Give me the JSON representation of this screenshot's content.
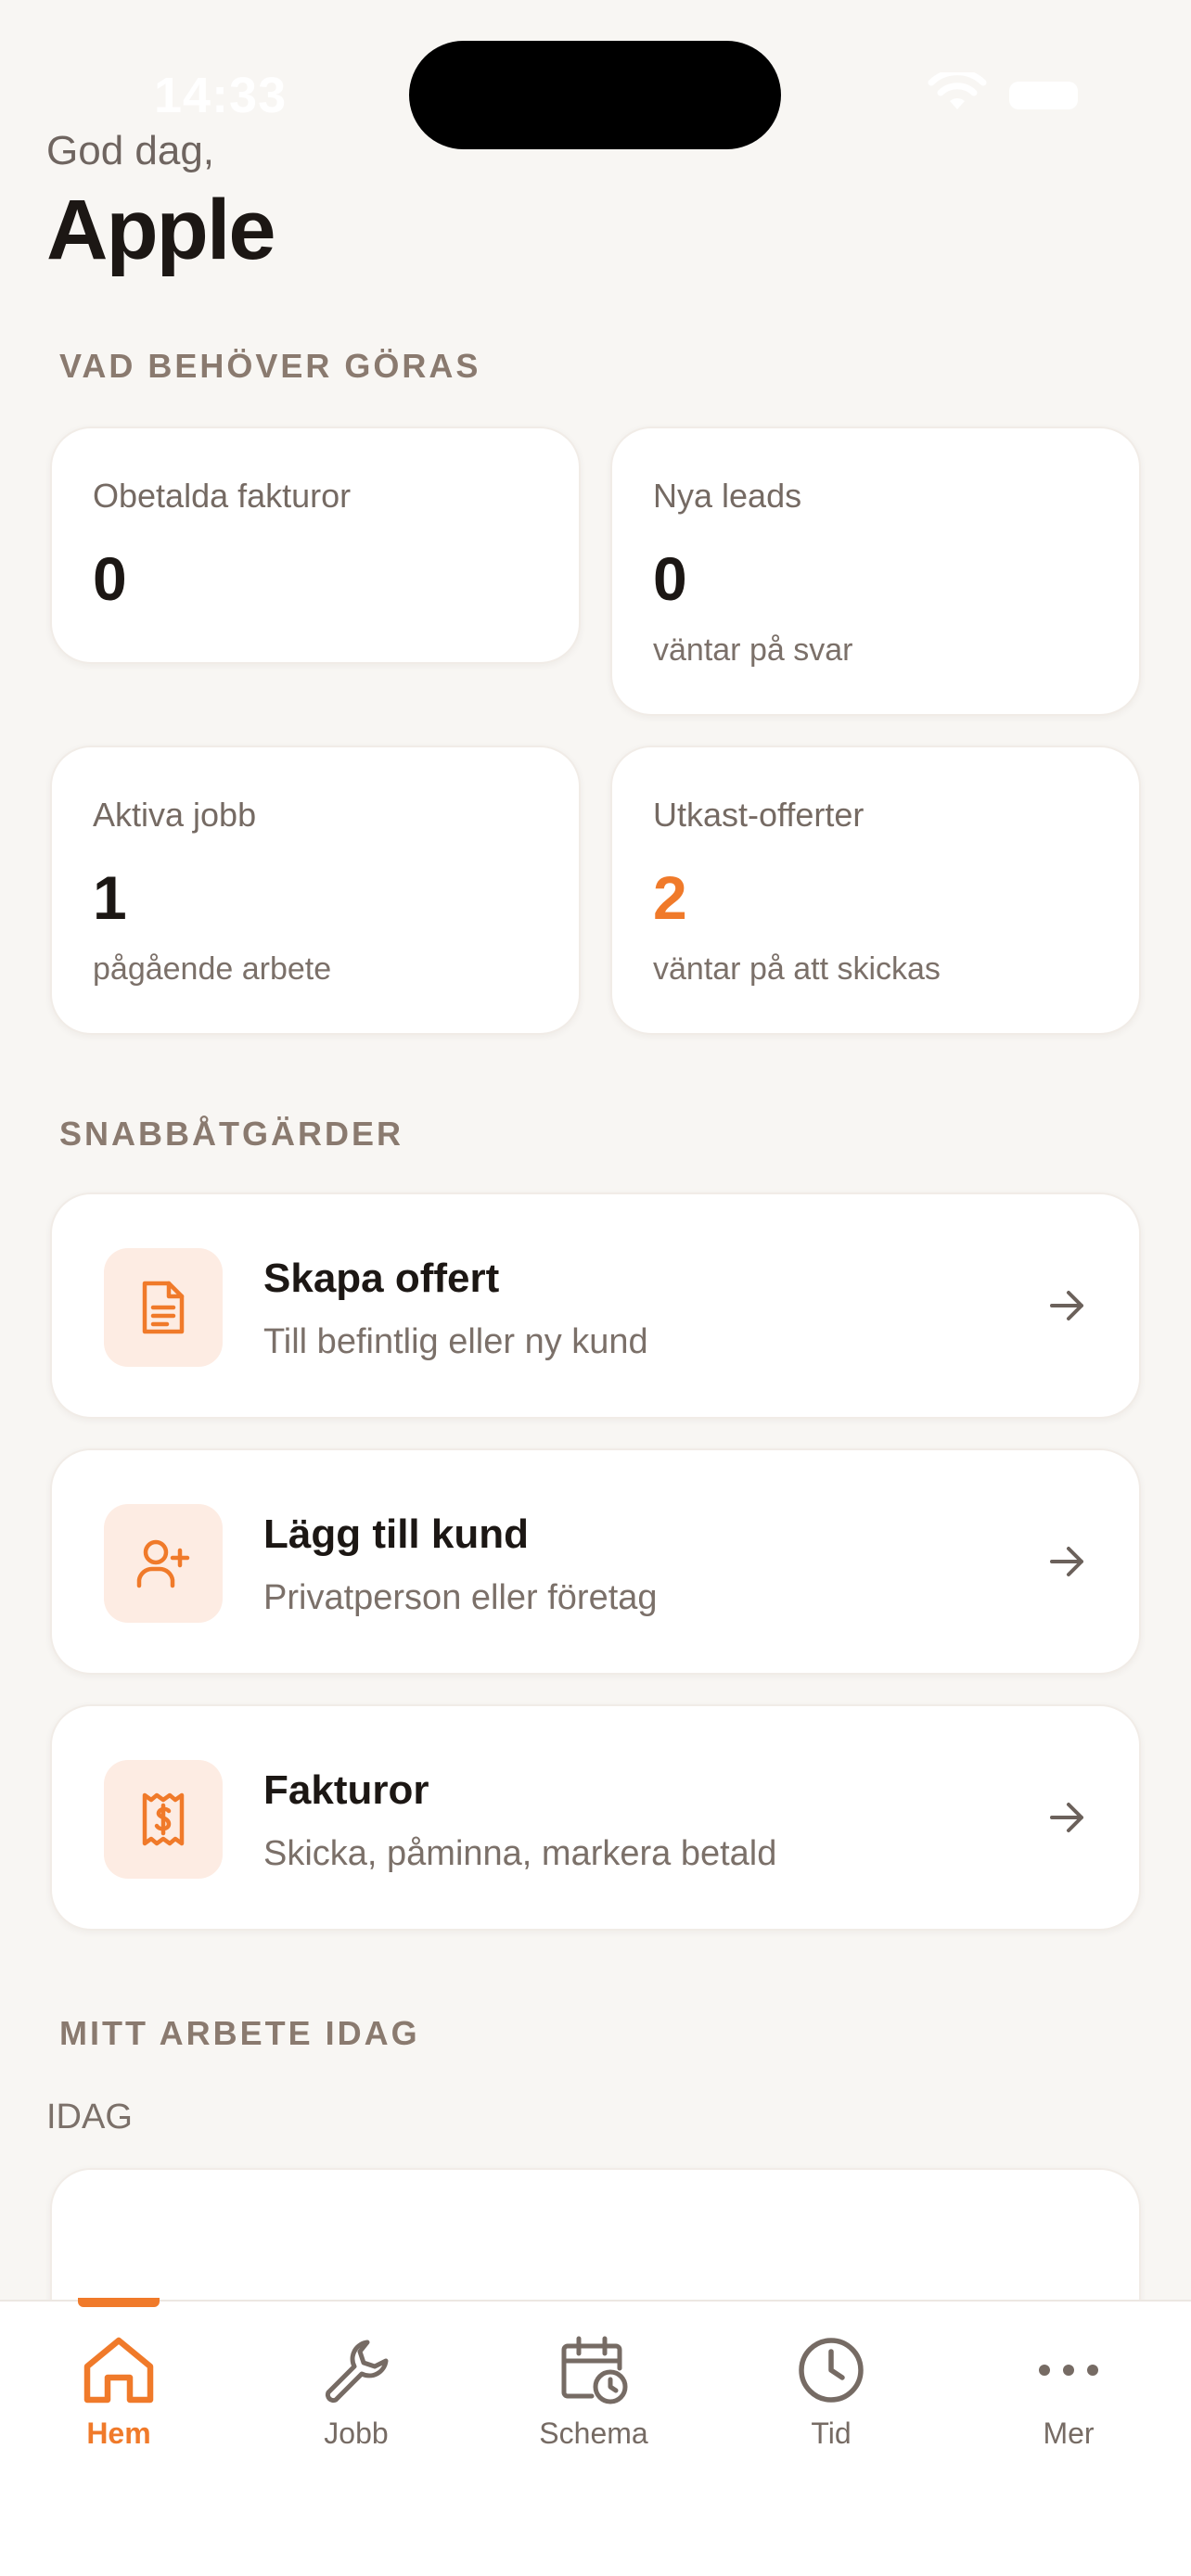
{
  "status": {
    "time": "14:33"
  },
  "header": {
    "greeting": "God dag,",
    "name": "Apple"
  },
  "sections": {
    "todo": "VAD BEHÖVER GÖRAS",
    "quick": "SNABBÅTGÄRDER",
    "today": "MITT ARBETE IDAG"
  },
  "stats": [
    {
      "label": "Obetalda fakturor",
      "value": "0",
      "sub": ""
    },
    {
      "label": "Nya leads",
      "value": "0",
      "sub": "väntar på svar"
    },
    {
      "label": "Aktiva jobb",
      "value": "1",
      "sub": "pågående arbete"
    },
    {
      "label": "Utkast-offerter",
      "value": "2",
      "sub": "väntar på att skickas"
    }
  ],
  "actions": [
    {
      "title": "Skapa offert",
      "sub": "Till befintlig eller ny kund",
      "icon": "document-icon"
    },
    {
      "title": "Lägg till kund",
      "sub": "Privatperson eller företag",
      "icon": "user-plus-icon"
    },
    {
      "title": "Fakturor",
      "sub": "Skicka, påminna, markera betald",
      "icon": "receipt-icon"
    }
  ],
  "today": {
    "label": "IDAG"
  },
  "tabs": [
    {
      "label": "Hem",
      "icon": "home-icon",
      "active": true
    },
    {
      "label": "Jobb",
      "icon": "wrench-icon",
      "active": false
    },
    {
      "label": "Schema",
      "icon": "calendar-clock-icon",
      "active": false
    },
    {
      "label": "Tid",
      "icon": "clock-icon",
      "active": false
    },
    {
      "label": "Mer",
      "icon": "more-icon",
      "active": false
    }
  ],
  "colors": {
    "accent": "#f07a2a",
    "accent_bg": "#fdece3",
    "background": "#f8f6f3",
    "section_title": "#8a7a6f"
  }
}
